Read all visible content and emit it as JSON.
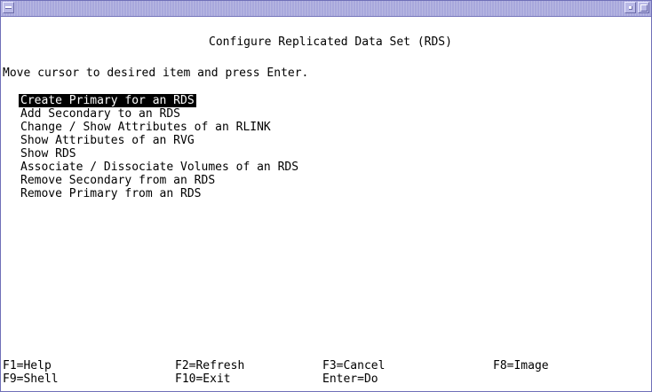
{
  "screen": {
    "title": "Configure Replicated Data Set (RDS)",
    "instructions": "Move cursor to desired item and press Enter."
  },
  "menu": {
    "selected_index": 0,
    "items": [
      {
        "label": "Create Primary for an RDS"
      },
      {
        "label": "Add Secondary to an RDS"
      },
      {
        "label": "Change / Show Attributes of an RLINK"
      },
      {
        "label": "Show Attributes of an RVG"
      },
      {
        "label": "Show RDS"
      },
      {
        "label": "Associate / Dissociate Volumes of an RDS"
      },
      {
        "label": "Remove Secondary from an RDS"
      },
      {
        "label": "Remove Primary from an RDS"
      }
    ]
  },
  "function_keys": {
    "row1": [
      "F1=Help",
      "F2=Refresh",
      "F3=Cancel",
      "F8=Image"
    ],
    "row2": [
      "F9=Shell",
      "F10=Exit",
      "Enter=Do"
    ]
  },
  "colors": {
    "titlebar": "#a8a8dc",
    "selection_bg": "#000000",
    "selection_fg": "#ffffff",
    "background": "#ffffff"
  }
}
